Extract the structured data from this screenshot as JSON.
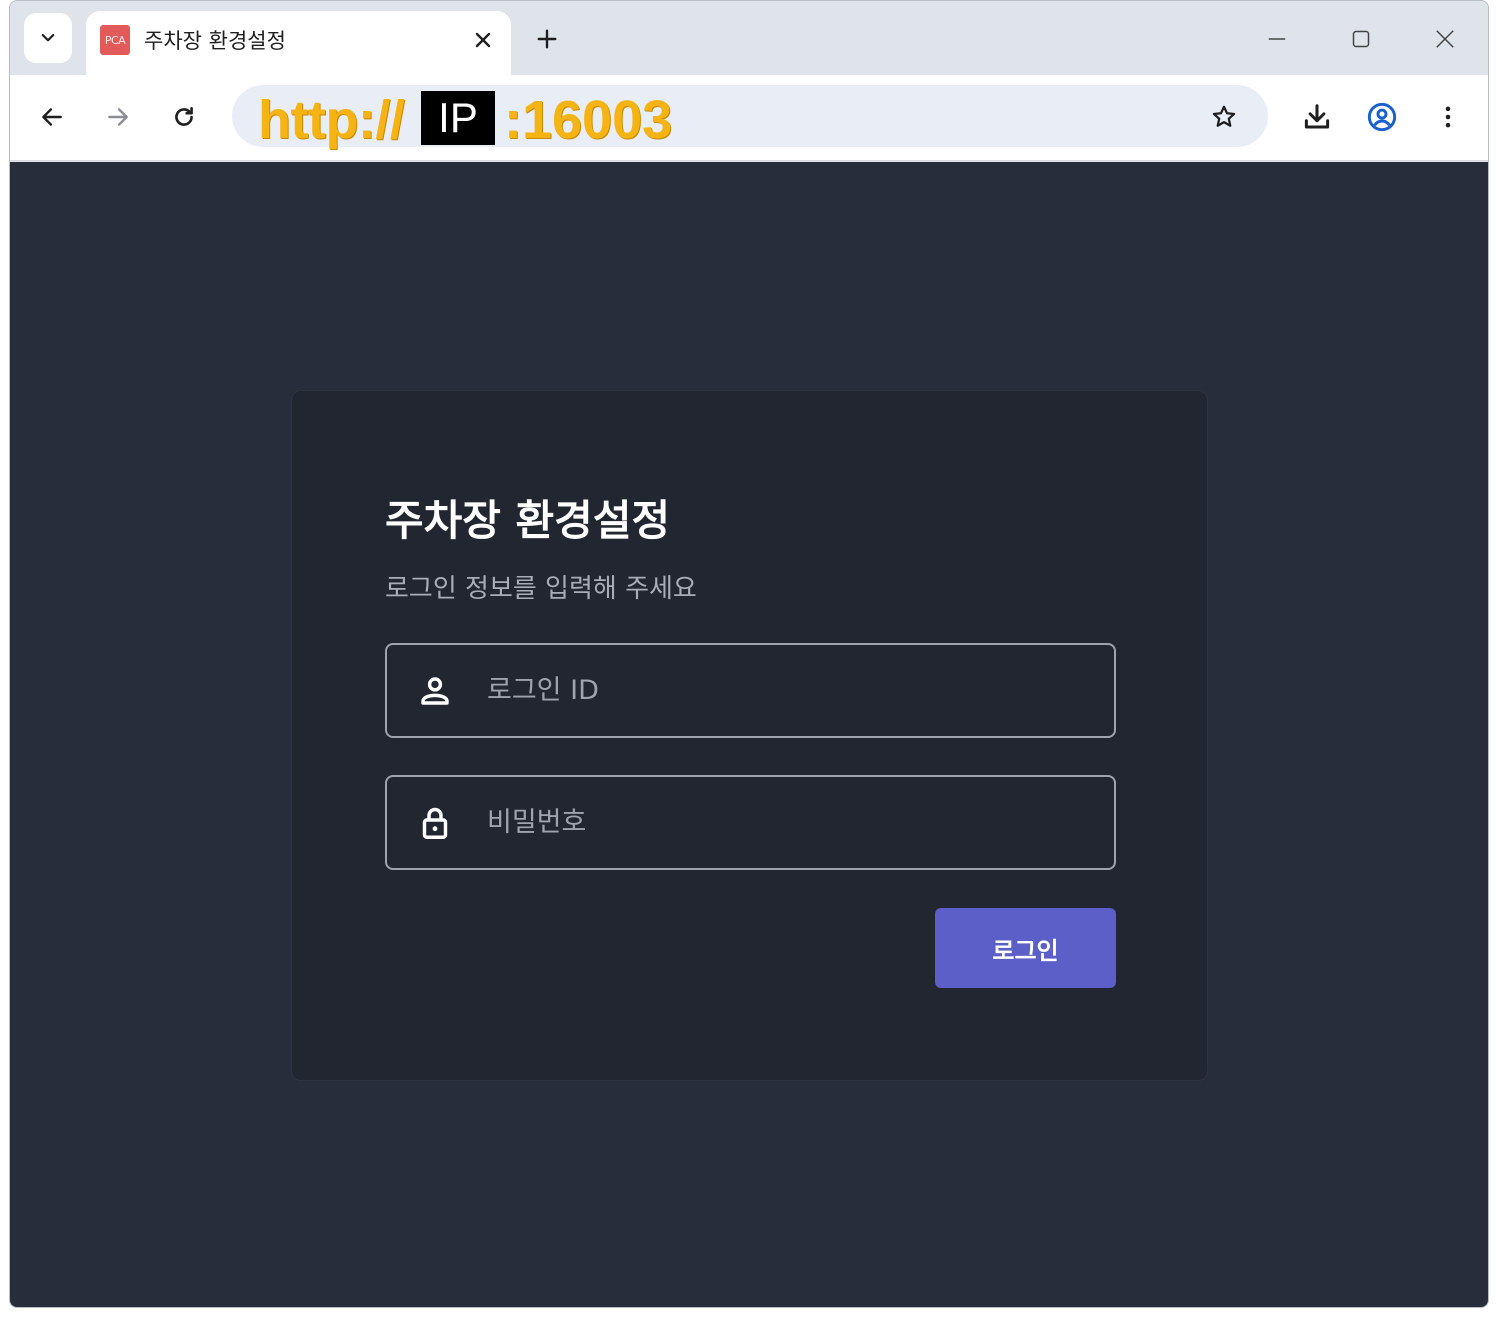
{
  "browser": {
    "tab": {
      "favicon_text": "PCA",
      "title": "주차장 환경설정"
    },
    "address": {
      "scheme": "http://",
      "ip_label": "IP",
      "port": ":16003"
    }
  },
  "login": {
    "title": "주차장 환경설정",
    "subtitle": "로그인 정보를 입력해 주세요",
    "id_placeholder": "로그인 ID",
    "password_placeholder": "비밀번호",
    "submit_label": "로그인"
  },
  "colors": {
    "page_background": "#282d3c",
    "card_background": "#222631",
    "primary_button": "#5b5fc7",
    "url_highlight": "#f6b414"
  },
  "icons": [
    "chevron-down-icon",
    "close-icon",
    "plus-icon",
    "minimize-icon",
    "maximize-icon",
    "back-icon",
    "forward-icon",
    "reload-icon",
    "star-icon",
    "download-icon",
    "profile-icon",
    "more-icon",
    "user-icon",
    "lock-icon"
  ]
}
